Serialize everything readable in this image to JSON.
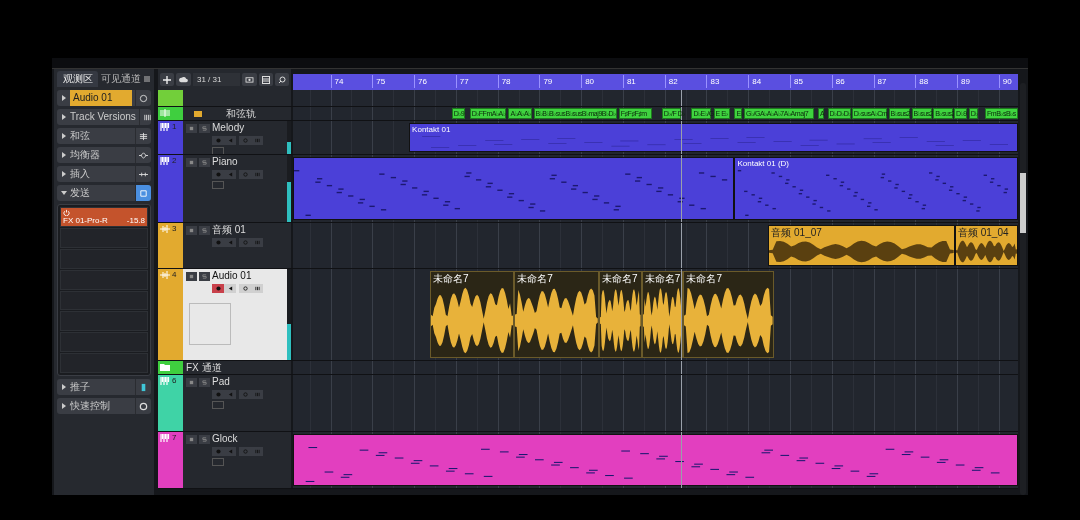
{
  "inspector": {
    "tabs": [
      {
        "label": "观测区",
        "selected": true
      },
      {
        "label": "可见通道",
        "selected": false
      }
    ],
    "sections": [
      {
        "kind": "track",
        "label": "Audio 01",
        "expanded": false
      },
      {
        "kind": "versions",
        "label": "Track Versions",
        "expanded": false
      },
      {
        "kind": "chords",
        "label": "和弦",
        "expanded": false
      },
      {
        "kind": "eq",
        "label": "均衡器",
        "expanded": false
      },
      {
        "kind": "inserts",
        "label": "插入",
        "expanded": false
      },
      {
        "kind": "sends",
        "label": "发送",
        "expanded": true,
        "sends": [
          {
            "kind": "filled",
            "name": "FX 01-Pro-R",
            "value": "-15.8"
          },
          {
            "kind": "empty"
          },
          {
            "kind": "empty"
          },
          {
            "kind": "empty"
          },
          {
            "kind": "empty"
          },
          {
            "kind": "empty"
          },
          {
            "kind": "empty"
          },
          {
            "kind": "empty"
          }
        ]
      },
      {
        "kind": "fader",
        "label": "推子",
        "expanded": false
      },
      {
        "kind": "quick",
        "label": "快速控制",
        "expanded": false
      }
    ]
  },
  "toolbar": {
    "count": "31 / 31"
  },
  "ruler": [
    "74",
    "75",
    "76",
    "77",
    "78",
    "79",
    "80",
    "81",
    "82",
    "83",
    "84",
    "85",
    "86",
    "87",
    "88",
    "89",
    "90"
  ],
  "tracks": [
    {
      "kind": "empty",
      "color": "#72cf3a"
    },
    {
      "kind": "chord",
      "name": "和弦轨",
      "color": "#3fcf3f",
      "chords": [
        "D♭9",
        "D♭FFmA♭A♭",
        "A♭A♭A♭",
        "B♭B♭B♭susB♭susB♭maj9B♭D♭",
        "F♯F♯F♯m",
        "D♭/F D♭",
        "D♭E♭/G",
        "E E♭",
        "E♭",
        "G♭/GA♭A♭A♭7A♭Amaj7",
        "A",
        "D♭D♭D♭",
        "D♭susA♭Cm",
        "B♭sus2",
        "B♭sus2",
        "B♭sus2",
        "D♭9",
        "D♭",
        "FmB♭sB♭s"
      ]
    },
    {
      "kind": "instrument",
      "number": "1",
      "name": "Melody",
      "color": "#4b40d8",
      "selected": false,
      "armed": false,
      "level": 0.35,
      "parts": [
        {
          "name": "Kontakt 01",
          "selected": false
        }
      ]
    },
    {
      "kind": "instrument",
      "number": "2",
      "name": "Piano",
      "color": "#4b40d8",
      "selected": false,
      "armed": false,
      "level": 0.6,
      "parts": [
        {
          "selected": false
        },
        {
          "name": "Kontakt 01 (D)",
          "selected": false
        }
      ]
    },
    {
      "kind": "audio",
      "number": "3",
      "name": "音频 01",
      "color": "#e2aa2f",
      "selected": false,
      "armed": false,
      "parts": [
        {
          "name": "音频 01_07",
          "selected": false
        },
        {
          "name": "音频 01_04",
          "selected": false
        }
      ]
    },
    {
      "kind": "audio",
      "number": "4",
      "name": "Audio 01",
      "color": "#e2aa2f",
      "selected": true,
      "armed": true,
      "level": 0.4,
      "parts": [
        {
          "name": "未命名7",
          "selected": true
        },
        {
          "name": "未命名7",
          "selected": true
        },
        {
          "name": "未命名7",
          "selected": true
        },
        {
          "name": "未命名7",
          "selected": true
        },
        {
          "name": "未命名7",
          "selected": true
        }
      ]
    },
    {
      "kind": "folder",
      "name": "FX 通道",
      "color": "#3fcf3f"
    },
    {
      "kind": "instrument",
      "number": "6",
      "name": "Pad",
      "color": "#3fd3a6",
      "selected": false,
      "armed": false
    },
    {
      "kind": "instrument",
      "number": "7",
      "name": "Glock",
      "color": "#e23fbf",
      "selected": false,
      "armed": false,
      "parts": [
        {
          "selected": false
        }
      ]
    }
  ]
}
